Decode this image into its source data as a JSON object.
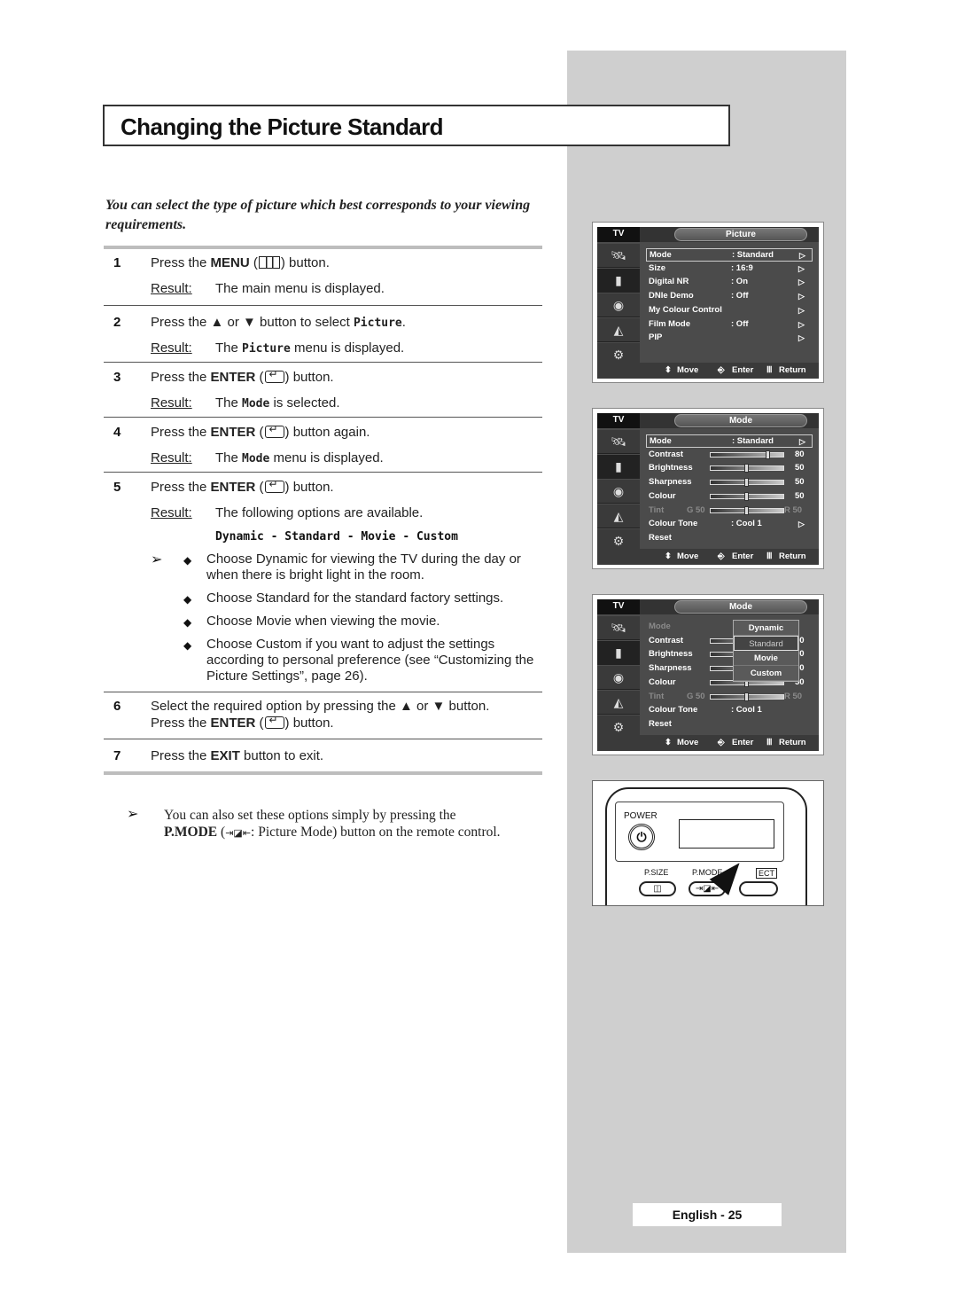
{
  "title": "Changing the Picture Standard",
  "intro": "You can select the type of picture which best corresponds to your viewing requirements.",
  "result_label": "Result:",
  "steps": [
    {
      "num": "1",
      "pre": "Press the ",
      "bold": "MENU",
      "mid": " (",
      "post": ") button.",
      "icon": "menu-icon",
      "result": "The main menu is displayed."
    },
    {
      "num": "2",
      "pre": "Press the ▲ or ▼ button to select ",
      "code": "Picture",
      "post": ".",
      "result_pre": "The ",
      "result_code": "Picture",
      "result_post": " menu is displayed."
    },
    {
      "num": "3",
      "pre": "Press the ",
      "bold": "ENTER",
      "mid": " (",
      "post": ") button.",
      "icon": "enter-icon",
      "result_pre": "The ",
      "result_code": "Mode",
      "result_post": " is selected."
    },
    {
      "num": "4",
      "pre": "Press the ",
      "bold": "ENTER",
      "mid": " (",
      "post": ") button again.",
      "icon": "enter-icon",
      "result_pre": "The ",
      "result_code": "Mode",
      "result_post": " menu is displayed."
    },
    {
      "num": "5",
      "pre": "Press the ",
      "bold": "ENTER",
      "mid": " (",
      "post": ") button.",
      "icon": "enter-icon",
      "result": "The following options are available.",
      "options": "Dynamic - Standard - Movie - Custom",
      "bullets": [
        "Choose Dynamic for viewing the TV during the day or when there is bright light in the room.",
        "Choose Standard for the standard factory settings.",
        "Choose Movie when viewing the movie.",
        "Choose Custom if you want to adjust the settings according to personal preference (see “Customizing the Picture Settings”, page 26)."
      ]
    },
    {
      "num": "6",
      "line1": "Select the required option by pressing the ▲ or ▼ button.",
      "pre": "Press the ",
      "bold": "ENTER",
      "mid": " (",
      "post": ") button.",
      "icon": "enter-icon"
    },
    {
      "num": "7",
      "pre": "Press the ",
      "bold": "EXIT",
      "post": " button to exit."
    }
  ],
  "note": {
    "line1": "You can also set these options simply by pressing the",
    "bold": "P.MODE",
    "mid": " (",
    "icon_glyph": "⇥◪⇤",
    "post": ": Picture Mode) button on the remote control."
  },
  "tv_screens": [
    {
      "tv_label": "TV",
      "title": "Picture",
      "rows": [
        {
          "label": "Mode",
          "value": ": Standard",
          "arrow": true,
          "highlight": true
        },
        {
          "label": "Size",
          "value": ": 16:9",
          "arrow": true
        },
        {
          "label": "Digital NR",
          "value": ": On",
          "arrow": true
        },
        {
          "label": "DNIe Demo",
          "value": ": Off",
          "arrow": true
        },
        {
          "label": "My Colour Control",
          "arrow": true
        },
        {
          "label": "Film Mode",
          "value": ": Off",
          "arrow": true
        },
        {
          "label": "PIP",
          "arrow": true
        }
      ],
      "footer": {
        "move": "Move",
        "enter": "Enter",
        "return": "Return"
      }
    },
    {
      "tv_label": "TV",
      "title": "Mode",
      "rows": [
        {
          "label": "Mode",
          "value": ": Standard",
          "arrow": true,
          "highlight": true
        },
        {
          "label": "Contrast",
          "slider": 80,
          "num": "80"
        },
        {
          "label": "Brightness",
          "slider": 50,
          "num": "50"
        },
        {
          "label": "Sharpness",
          "slider": 50,
          "num": "50"
        },
        {
          "label": "Colour",
          "slider": 50,
          "num": "50"
        },
        {
          "label": "Tint",
          "dim": true,
          "left": "G 50",
          "slider": 50,
          "right": "R 50"
        },
        {
          "label": "Colour Tone",
          "value": ": Cool 1",
          "arrow": true
        },
        {
          "label": "Reset"
        }
      ],
      "footer": {
        "move": "Move",
        "enter": "Enter",
        "return": "Return"
      }
    },
    {
      "tv_label": "TV",
      "title": "Mode",
      "rows": [
        {
          "label": "Mode",
          "dimlabel": true
        },
        {
          "label": "Contrast",
          "slider": 80,
          "num": "80"
        },
        {
          "label": "Brightness",
          "slider": 50,
          "num": "50"
        },
        {
          "label": "Sharpness",
          "slider": 50,
          "num": "50"
        },
        {
          "label": "Colour",
          "slider": 50,
          "num": "50"
        },
        {
          "label": "Tint",
          "dim": true,
          "left": "G 50",
          "slider": 50,
          "right": "R 50"
        },
        {
          "label": "Colour Tone",
          "value": ": Cool 1"
        },
        {
          "label": "Reset"
        }
      ],
      "popup": {
        "items": [
          "Dynamic",
          "Standard",
          "Movie",
          "Custom"
        ],
        "current": "Standard"
      },
      "footer": {
        "move": "Move",
        "enter": "Enter",
        "return": "Return"
      }
    }
  ],
  "remote": {
    "power": "POWER",
    "psize": "P.SIZE",
    "pmode": "P.MODE",
    "select": "ECT"
  },
  "footer": "English - 25"
}
